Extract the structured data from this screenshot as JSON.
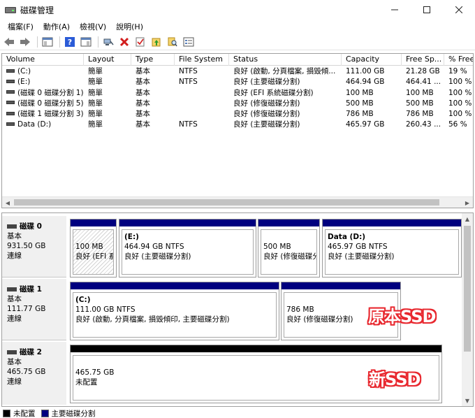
{
  "window": {
    "title": "磁碟管理",
    "minimize": "—",
    "maximize": "☐",
    "close": "✕"
  },
  "menu": [
    {
      "label": "檔案(F)"
    },
    {
      "label": "動作(A)"
    },
    {
      "label": "檢視(V)"
    },
    {
      "label": "說明(H)"
    }
  ],
  "toolbar": {
    "buttons": [
      "back-icon",
      "forward-icon",
      "console-tree-icon",
      "help-icon",
      "properties-icon",
      "connect-icon",
      "delete-icon",
      "check-icon",
      "up-folder-icon",
      "search-icon",
      "list-icon"
    ]
  },
  "volumes": {
    "columns": [
      "Volume",
      "Layout",
      "Type",
      "File System",
      "Status",
      "Capacity",
      "Free Sp...",
      "% Free"
    ],
    "rows": [
      [
        "(C:)",
        "簡單",
        "基本",
        "NTFS",
        "良好 (啟動, 分頁檔案, 損毀傾...",
        "111.00 GB",
        "21.28 GB",
        "19 %"
      ],
      [
        "(E:)",
        "簡單",
        "基本",
        "NTFS",
        "良好 (主要磁碟分割)",
        "464.94 GB",
        "464.41 ...",
        "100 %"
      ],
      [
        "(磁碟 0 磁碟分割 1)",
        "簡單",
        "基本",
        "",
        "良好 (EFI 系統磁碟分割)",
        "100 MB",
        "100 MB",
        "100 %"
      ],
      [
        "(磁碟 0 磁碟分割 5)",
        "簡單",
        "基本",
        "",
        "良好 (修復磁碟分割)",
        "500 MB",
        "500 MB",
        "100 %"
      ],
      [
        "(磁碟 1 磁碟分割 3)",
        "簡單",
        "基本",
        "",
        "良好 (修復磁碟分割)",
        "786 MB",
        "786 MB",
        "100 %"
      ],
      [
        "Data (D:)",
        "簡單",
        "基本",
        "NTFS",
        "良好 (主要磁碟分割)",
        "465.97 GB",
        "260.43 ...",
        "56 %"
      ]
    ]
  },
  "disks": [
    {
      "name": "磁碟 0",
      "type": "基本",
      "size": "931.50 GB",
      "status": "連線",
      "partitions": [
        {
          "title": "",
          "line1": "100 MB",
          "line2": "良好 (EFI 系"
        },
        {
          "title": "(E:)",
          "line1": "464.94 GB NTFS",
          "line2": "良好 (主要磁碟分割)"
        },
        {
          "title": "",
          "line1": "500 MB",
          "line2": "良好 (修復磁碟分"
        },
        {
          "title": "Data  (D:)",
          "line1": "465.97 GB NTFS",
          "line2": "良好 (主要磁碟分割)"
        }
      ]
    },
    {
      "name": "磁碟 1",
      "type": "基本",
      "size": "111.77 GB",
      "status": "連線",
      "partitions": [
        {
          "title": "(C:)",
          "line1": "111.00 GB NTFS",
          "line2": "良好 (啟動, 分頁檔案, 損毀傾印, 主要磁碟分割)"
        },
        {
          "title": "",
          "line1": "786 MB",
          "line2": "良好 (修復磁碟分割)"
        }
      ]
    },
    {
      "name": "磁碟 2",
      "type": "基本",
      "size": "465.75 GB",
      "status": "連線",
      "partitions": [
        {
          "title": "",
          "line1": "465.75 GB",
          "line2": "未配置"
        }
      ]
    }
  ],
  "annotations": {
    "original_ssd": "原本SSD",
    "new_ssd": "新SSD"
  },
  "legend": {
    "unallocated": "未配置",
    "primary": "主要磁碟分割"
  },
  "colors": {
    "primary_bar": "#00007f",
    "unallocated_bar": "#000000",
    "annotation": "#e8282f"
  }
}
